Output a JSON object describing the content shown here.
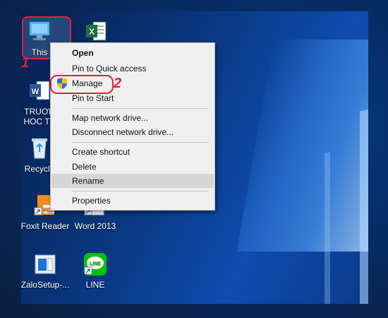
{
  "desktop": {
    "icons": [
      {
        "label": "This",
        "icon": "this-pc-icon"
      },
      {
        "label": "",
        "icon": "excel-icon"
      },
      {
        "label": "TRUƠN\nHOC TÂ",
        "icon": "word-doc-icon"
      },
      {
        "label": "Recycle",
        "icon": "recycle-bin-icon"
      },
      {
        "label": "Foxit Reader",
        "icon": "foxit-reader-icon"
      },
      {
        "label": "Word 2013",
        "icon": "word-2013-icon"
      },
      {
        "label": "ZaloSetup-...",
        "icon": "zalo-setup-icon"
      },
      {
        "label": "LINE",
        "icon": "line-icon"
      }
    ]
  },
  "markers": {
    "one": "1",
    "two": "2"
  },
  "context_menu": {
    "items": [
      {
        "label": "Open",
        "bold": true
      },
      {
        "label": "Pin to Quick access"
      },
      {
        "label": "Manage",
        "icon": "shield-icon"
      },
      {
        "label": "Pin to Start"
      },
      {
        "label": "Map network drive..."
      },
      {
        "label": "Disconnect network drive..."
      },
      {
        "label": "Create shortcut"
      },
      {
        "label": "Delete"
      },
      {
        "label": "Rename",
        "highlighted": true
      },
      {
        "label": "Properties"
      }
    ]
  },
  "colors": {
    "annotation": "#e0203a",
    "menu_bg": "#f0f0f0",
    "menu_highlight": "#d6d6d6"
  }
}
